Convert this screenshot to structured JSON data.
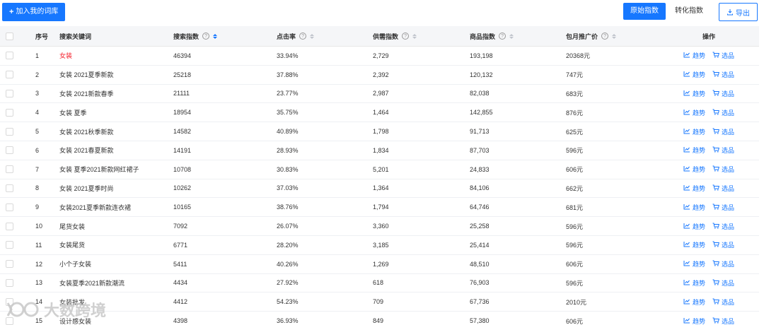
{
  "toolbar": {
    "add_label": "加入我的词库",
    "raw_index_label": "原始指数",
    "conversion_index_label": "转化指数",
    "export_label": "导出"
  },
  "table": {
    "headers": {
      "index": "序号",
      "keyword": "搜索关键词",
      "search_index": "搜索指数",
      "click_rate": "点击率",
      "supply_index": "供需指数",
      "goods_index": "商品指数",
      "monthly_price": "包月推广价",
      "actions": "操作"
    },
    "action_trend_label": "趋势",
    "action_select_label": "选品",
    "rows": [
      {
        "idx": "1",
        "keyword": "女装",
        "search": "46394",
        "click": "33.94%",
        "supply": "2,729",
        "goods": "193,198",
        "price": "20368元"
      },
      {
        "idx": "2",
        "keyword": "女装 2021夏季新款",
        "search": "25218",
        "click": "37.88%",
        "supply": "2,392",
        "goods": "120,132",
        "price": "747元"
      },
      {
        "idx": "3",
        "keyword": "女装 2021新款春季",
        "search": "21111",
        "click": "23.77%",
        "supply": "2,987",
        "goods": "82,038",
        "price": "683元"
      },
      {
        "idx": "4",
        "keyword": "女装 夏季",
        "search": "18954",
        "click": "35.75%",
        "supply": "1,464",
        "goods": "142,855",
        "price": "876元"
      },
      {
        "idx": "5",
        "keyword": "女装 2021秋季新款",
        "search": "14582",
        "click": "40.89%",
        "supply": "1,798",
        "goods": "91,713",
        "price": "625元"
      },
      {
        "idx": "6",
        "keyword": "女装 2021春夏新款",
        "search": "14191",
        "click": "28.93%",
        "supply": "1,834",
        "goods": "87,703",
        "price": "596元"
      },
      {
        "idx": "7",
        "keyword": "女装 夏季2021新款网红裙子",
        "search": "10708",
        "click": "30.83%",
        "supply": "5,201",
        "goods": "24,833",
        "price": "606元"
      },
      {
        "idx": "8",
        "keyword": "女装 2021夏季时尚",
        "search": "10262",
        "click": "37.03%",
        "supply": "1,364",
        "goods": "84,106",
        "price": "662元"
      },
      {
        "idx": "9",
        "keyword": "女装2021夏季新款连衣裙",
        "search": "10165",
        "click": "38.76%",
        "supply": "1,794",
        "goods": "64,746",
        "price": "681元"
      },
      {
        "idx": "10",
        "keyword": "尾货女装",
        "search": "7092",
        "click": "26.07%",
        "supply": "3,360",
        "goods": "25,258",
        "price": "596元"
      },
      {
        "idx": "11",
        "keyword": "女装尾货",
        "search": "6771",
        "click": "28.20%",
        "supply": "3,185",
        "goods": "25,414",
        "price": "596元"
      },
      {
        "idx": "12",
        "keyword": "小个子女装",
        "search": "5411",
        "click": "40.26%",
        "supply": "1,269",
        "goods": "48,510",
        "price": "606元"
      },
      {
        "idx": "13",
        "keyword": "女装夏季2021新款潮流",
        "search": "4434",
        "click": "27.92%",
        "supply": "618",
        "goods": "76,903",
        "price": "596元"
      },
      {
        "idx": "14",
        "keyword": "女装批发",
        "search": "4412",
        "click": "54.23%",
        "supply": "709",
        "goods": "67,736",
        "price": "2010元"
      },
      {
        "idx": "15",
        "keyword": "设计感女装",
        "search": "4398",
        "click": "36.93%",
        "supply": "849",
        "goods": "57,380",
        "price": "606元"
      }
    ]
  },
  "watermark": {
    "text": "大数跨境"
  },
  "colors": {
    "accent": "#1677ff",
    "highlight_keyword": "#f5222d"
  }
}
